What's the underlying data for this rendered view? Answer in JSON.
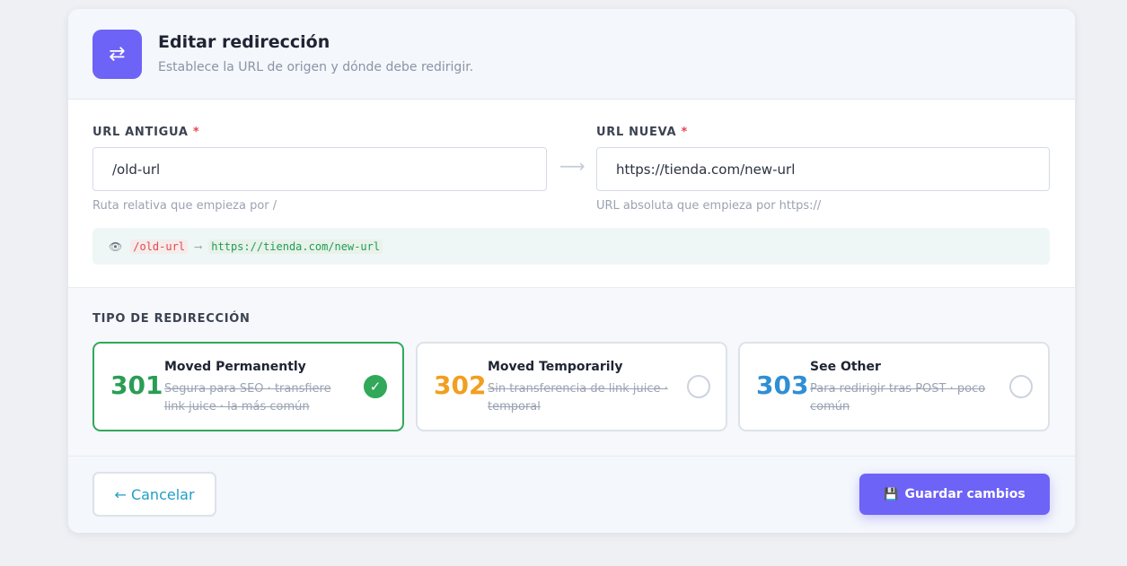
{
  "header": {
    "icon": "swap-arrows-icon",
    "title": "Editar redirección",
    "subtitle": "Establece la URL de origen y dónde debe redirigir."
  },
  "old_url": {
    "label": "URL ANTIGUA",
    "required_mark": "*",
    "value": "/old-url",
    "hint": "Ruta relativa que empieza por /"
  },
  "arrow": "⟶",
  "new_url": {
    "label": "URL NUEVA",
    "required_mark": "*",
    "value": "https://tienda.com/new-url",
    "hint": "URL absoluta que empieza por https://"
  },
  "preview": {
    "icon": "eye-icon",
    "from": "/old-url",
    "arrow": "⟶",
    "to": "https://tienda.com/new-url"
  },
  "redirect_type": {
    "label": "TIPO DE REDIRECCIÓN",
    "options": [
      {
        "code": "301",
        "title": "Moved Permanently",
        "desc": "Segura para SEO · transfiere link juice · la más común",
        "color": "#2a9d55",
        "selected": true,
        "check": "✓"
      },
      {
        "code": "302",
        "title": "Moved Temporarily",
        "desc": "Sin transferencia de link juice · temporal",
        "color": "#f29e1f",
        "selected": false,
        "check": ""
      },
      {
        "code": "303",
        "title": "See Other",
        "desc": "Para redirigir tras POST · poco común",
        "color": "#2f8fd4",
        "selected": false,
        "check": ""
      }
    ]
  },
  "footer": {
    "cancel_label": "← Cancelar",
    "save_icon": "floppy-disk-icon",
    "save_label": "Guardar cambios"
  },
  "colors": {
    "accent": "#6d63f6",
    "success": "#31a85a",
    "danger": "#e5484d"
  }
}
